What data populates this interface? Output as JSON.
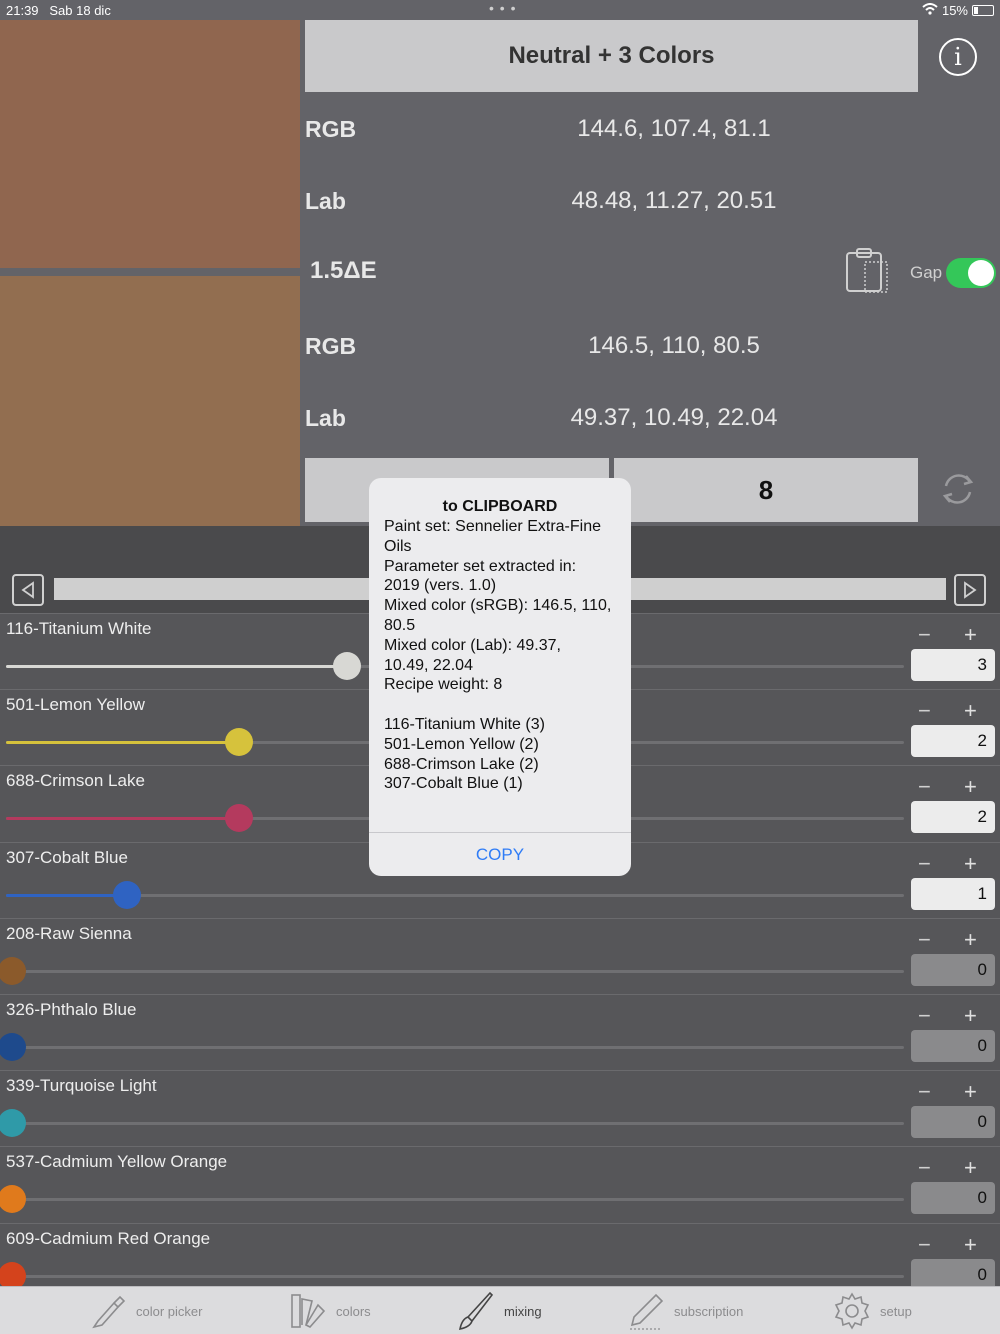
{
  "status": {
    "time": "21:39",
    "date": "Sab 18 dic",
    "battery": "15%"
  },
  "swatches": {
    "target_color": "#90664f",
    "mixed_color": "#926e50"
  },
  "header": {
    "title": "Neutral + 3 Colors"
  },
  "target": {
    "rgb_label": "RGB",
    "rgb_value": "144.6, 107.4, 81.1",
    "lab_label": "Lab",
    "lab_value": "48.48, 11.27, 20.51"
  },
  "delta": {
    "value": "1.5ΔE",
    "gap_label": "Gap",
    "gap_on": true
  },
  "mixed": {
    "rgb_label": "RGB",
    "rgb_value": "146.5, 110, 80.5",
    "lab_label": "Lab",
    "lab_value": "49.37, 10.49, 22.04"
  },
  "weight_button": "8",
  "paints": [
    {
      "name": "116-Titanium White",
      "qty": "3",
      "level": 0.38,
      "color": "#d8d8d4",
      "active": true
    },
    {
      "name": "501-Lemon Yellow",
      "qty": "2",
      "level": 0.26,
      "color": "#d6c23c",
      "active": true
    },
    {
      "name": "688-Crimson Lake",
      "qty": "2",
      "level": 0.26,
      "color": "#b43a5e",
      "active": true
    },
    {
      "name": "307-Cobalt Blue",
      "qty": "1",
      "level": 0.135,
      "color": "#2f63c2",
      "active": true
    },
    {
      "name": "208-Raw Sienna",
      "qty": "0",
      "level": 0,
      "color": "#8b5a2b",
      "active": false
    },
    {
      "name": "326-Phthalo Blue",
      "qty": "0",
      "level": 0,
      "color": "#1e4a8c",
      "active": false
    },
    {
      "name": "339-Turquoise Light",
      "qty": "0",
      "level": 0,
      "color": "#2f9aa8",
      "active": false
    },
    {
      "name": "537-Cadmium Yellow Orange",
      "qty": "0",
      "level": 0,
      "color": "#e07a1c",
      "active": false
    },
    {
      "name": "609-Cadmium Red Orange",
      "qty": "0",
      "level": 0,
      "color": "#d4431c",
      "active": false
    }
  ],
  "dialog": {
    "title": "to CLIPBOARD",
    "lines": [
      "Paint set: Sennelier Extra-Fine",
      "Oils",
      "Parameter set extracted in:",
      "2019 (vers. 1.0)",
      "Mixed color (sRGB): 146.5, 110,",
      "80.5",
      "Mixed color (Lab): 49.37,",
      "10.49, 22.04",
      "Recipe weight: 8",
      "",
      "116-Titanium White (3)",
      "501-Lemon Yellow (2)",
      "688-Crimson Lake (2)",
      "307-Cobalt Blue (1)"
    ],
    "button": "COPY"
  },
  "tabs": [
    {
      "label": "color picker",
      "icon": "eyedropper-icon"
    },
    {
      "label": "colors",
      "icon": "color-swatches-icon"
    },
    {
      "label": "mixing",
      "icon": "brush-icon",
      "active": true
    },
    {
      "label": "subscription",
      "icon": "pen-icon"
    },
    {
      "label": "setup",
      "icon": "gear-icon"
    }
  ]
}
